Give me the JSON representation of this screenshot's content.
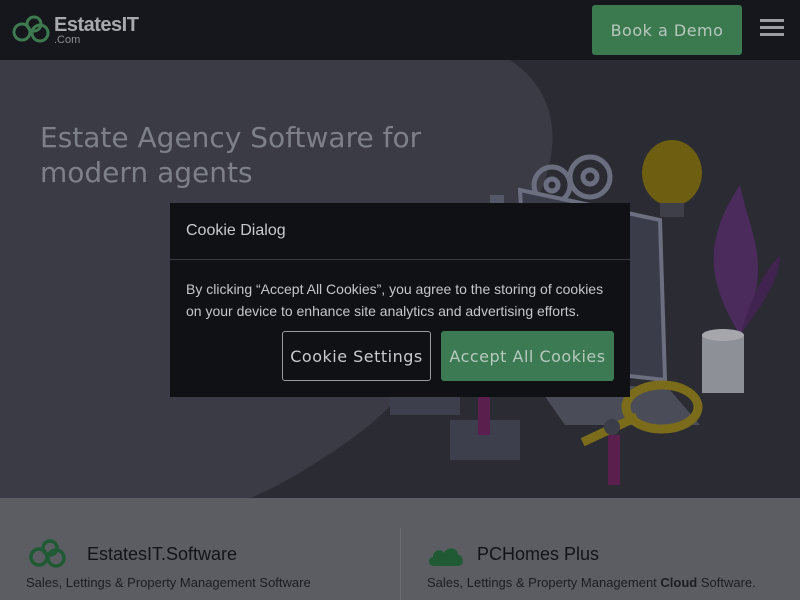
{
  "header": {
    "logo_text": "EstatesIT",
    "logo_sub": ".Com",
    "demo_button": "Book a Demo",
    "menu_icon": "hamburger-icon"
  },
  "hero": {
    "title": "Estate Agency Software for modern agents"
  },
  "features": [
    {
      "icon": "rings-logo-icon",
      "title": "EstatesIT.Software",
      "description": "Sales, Lettings & Property Management Software"
    },
    {
      "icon": "cloud-icon",
      "title": "PCHomes Plus",
      "description_before": "Sales, Lettings & Property Management ",
      "description_bold": "Cloud",
      "description_after": " Software."
    }
  ],
  "cookie_dialog": {
    "title": "Cookie Dialog",
    "text": "By clicking “Accept All Cookies”, you agree to the storing of cookies on your device to enhance site analytics and advertising efforts.",
    "settings_button": "Cookie Settings",
    "accept_button": "Accept All Cookies"
  },
  "colors": {
    "brand_green": "#3a7a4e",
    "header_bg": "#15171d",
    "hero_bg": "#2a2b33"
  }
}
